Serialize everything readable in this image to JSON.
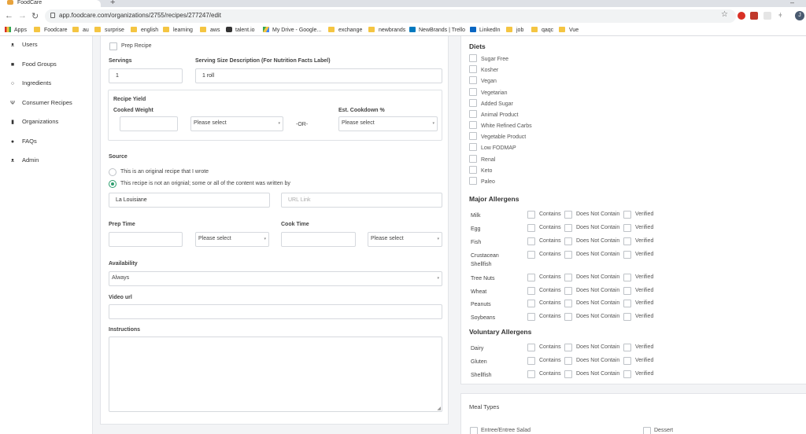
{
  "browser": {
    "tab_title": "FoodCare",
    "url": "app.foodcare.com/organizations/2755/recipes/277247/edit",
    "profile_initial": "J",
    "bookmarks": [
      "Apps",
      "Foodcare",
      "au",
      "surprise",
      "english",
      "learning",
      "aws",
      "talent.io",
      "My Drive - Google...",
      "exchange",
      "newbrands",
      "NewBrands | Trello",
      "LinkedIn",
      "job",
      "qaqc",
      "Vue"
    ]
  },
  "sidebar": {
    "items": [
      {
        "label": "Users",
        "icon": "users-icon"
      },
      {
        "label": "Food Groups",
        "icon": "bookmark-icon"
      },
      {
        "label": "Ingredients",
        "icon": "leaf-icon"
      },
      {
        "label": "Consumer Recipes",
        "icon": "utensils-icon"
      },
      {
        "label": "Organizations",
        "icon": "building-icon"
      },
      {
        "label": "FAQs",
        "icon": "question-circle-icon"
      },
      {
        "label": "Admin",
        "icon": "users-cog-icon"
      }
    ]
  },
  "form": {
    "prep_recipe_label": "Prep Recipe",
    "servings_label": "Servings",
    "servings_value": "1",
    "serving_size_label": "Serving Size Description (For Nutrition Facts Label)",
    "serving_size_value": "1 roll",
    "recipe_yield_label": "Recipe Yield",
    "cooked_weight_label": "Cooked Weight",
    "cooked_weight_unit": "Please select",
    "or_text": "-OR-",
    "cookdown_label": "Est. Cookdown %",
    "cookdown_value": "Please select",
    "source_label": "Source",
    "source_option_original": "This is an original recipe that I wrote",
    "source_option_not_original": "This recipe is not an orignial; some or all of the content was written by",
    "source_author": "La Louisiane",
    "url_link_placeholder": "URL Link",
    "prep_time_label": "Prep Time",
    "prep_time_unit": "Please select",
    "cook_time_label": "Cook Time",
    "cook_time_unit": "Please select",
    "availability_label": "Availability",
    "availability_value": "Always",
    "video_url_label": "Video url",
    "instructions_label": "Instructions"
  },
  "diets": {
    "title": "Diets",
    "items": [
      "Sugar Free",
      "Kosher",
      "Vegan",
      "Vegetarian",
      "Added Sugar",
      "Animal Product",
      "White Refined Carbs",
      "Vegetable Product",
      "Low FODMAP",
      "Renal",
      "Keto",
      "Paleo"
    ]
  },
  "allergen_options": {
    "contains": "Contains",
    "does_not_contain": "Does Not Contain",
    "verified": "Verified"
  },
  "major_allergens": {
    "title": "Major Allergens",
    "items": [
      "Milk",
      "Egg",
      "Fish",
      "Crustacean Shellfish",
      "Tree Nuts",
      "Wheat",
      "Peanuts",
      "Soybeans"
    ]
  },
  "voluntary_allergens": {
    "title": "Voluntary Allergens",
    "items": [
      "Dairy",
      "Gluten",
      "Shellfish"
    ]
  },
  "meal_types": {
    "title": "Meal Types",
    "items": [
      "Entree/Entree Salad",
      "Dessert"
    ]
  }
}
